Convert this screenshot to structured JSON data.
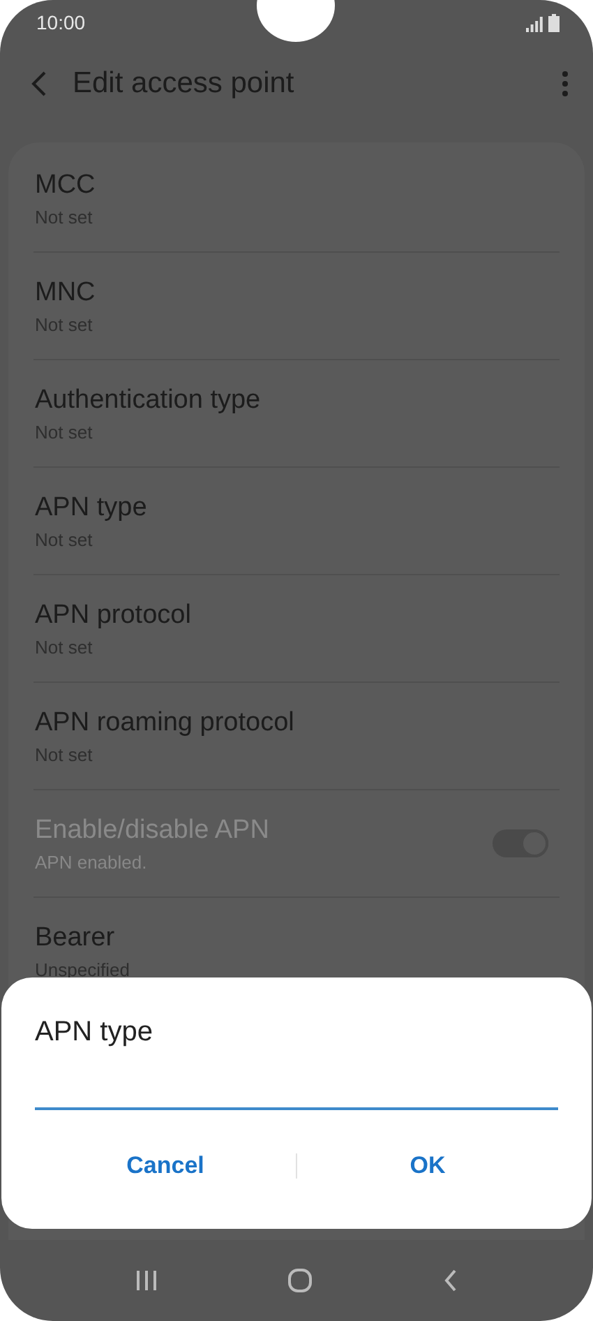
{
  "status_bar": {
    "time": "10:00"
  },
  "header": {
    "title": "Edit access point"
  },
  "settings": [
    {
      "kind": "text",
      "title": "MCC",
      "subtitle": "Not set",
      "disabled": false
    },
    {
      "kind": "text",
      "title": "MNC",
      "subtitle": "Not set",
      "disabled": false
    },
    {
      "kind": "text",
      "title": "Authentication type",
      "subtitle": "Not set",
      "disabled": false
    },
    {
      "kind": "text",
      "title": "APN type",
      "subtitle": "Not set",
      "disabled": false
    },
    {
      "kind": "text",
      "title": "APN protocol",
      "subtitle": "Not set",
      "disabled": false
    },
    {
      "kind": "text",
      "title": "APN roaming protocol",
      "subtitle": "Not set",
      "disabled": false
    },
    {
      "kind": "switch",
      "title": "Enable/disable APN",
      "subtitle": "APN enabled.",
      "disabled": true,
      "on": true
    },
    {
      "kind": "text",
      "title": "Bearer",
      "subtitle": "Unspecified",
      "disabled": false
    }
  ],
  "dialog": {
    "title": "APN type",
    "field": {
      "focused": true
    },
    "buttons": [
      "Cancel",
      "OK"
    ]
  }
}
